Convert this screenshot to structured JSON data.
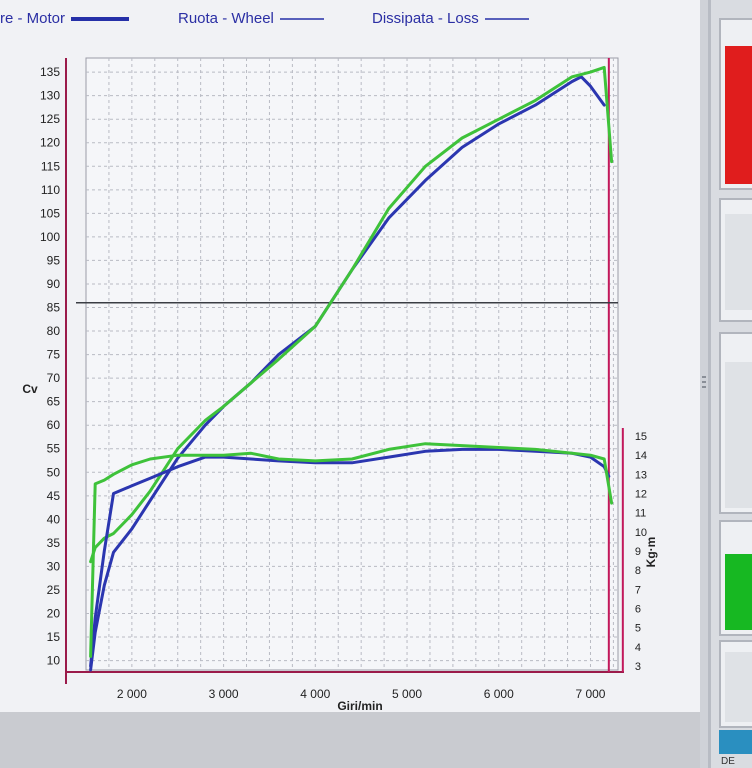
{
  "legend": {
    "items": [
      {
        "label": "re - Motor",
        "color": "#2630a8"
      },
      {
        "label": "Ruota - Wheel",
        "color": "#2630a8"
      },
      {
        "label": "Dissipata - Loss",
        "color": "#2630a8"
      }
    ]
  },
  "chart_data": {
    "type": "line",
    "xlabel": "Giri/min",
    "ylabel_left": "Cv",
    "ylabel_right": "Kg·m",
    "xlim": [
      1500,
      7300
    ],
    "ylim_left": [
      8,
      138
    ],
    "ylim_right": [
      3,
      15
    ],
    "x_ticks": [
      2000,
      3000,
      4000,
      5000,
      6000,
      7000
    ],
    "x_tick_labels": [
      "2 000",
      "3 000",
      "4 000",
      "5 000",
      "6 000",
      "7 000"
    ],
    "y_left_ticks": [
      10,
      15,
      20,
      25,
      30,
      35,
      40,
      45,
      50,
      55,
      60,
      65,
      70,
      75,
      80,
      85,
      90,
      95,
      100,
      105,
      110,
      115,
      120,
      125,
      130,
      135
    ],
    "y_right_ticks": [
      3,
      4,
      5,
      6,
      7,
      8,
      9,
      10,
      11,
      12,
      13,
      14,
      15
    ],
    "reference_line_cv": 86,
    "rpm_limit_line": 7200,
    "grid": true,
    "series": [
      {
        "name": "",
        "axis": "left",
        "color": "#2b36b0",
        "x": [
          1550,
          1600,
          1700,
          1800,
          2000,
          2200,
          2500,
          2800,
          3000,
          3300,
          3600,
          4000,
          4400,
          4800,
          5200,
          5600,
          6000,
          6400,
          6800,
          6900,
          7000,
          7150
        ],
        "y": [
          8,
          16,
          26,
          33,
          38,
          44,
          53,
          60,
          64,
          69,
          75,
          81,
          93,
          104,
          112,
          119,
          124,
          128,
          133,
          134,
          132,
          128
        ]
      },
      {
        "name": "",
        "axis": "left",
        "color": "#3ec23a",
        "x": [
          1550,
          1600,
          1700,
          1800,
          2000,
          2200,
          2500,
          2800,
          3000,
          3300,
          3600,
          4000,
          4400,
          4800,
          5200,
          5600,
          6000,
          6400,
          6800,
          7000,
          7150,
          7230
        ],
        "y": [
          31,
          34,
          36,
          37,
          41,
          46,
          55,
          61,
          64,
          69,
          74,
          81,
          93,
          106,
          115,
          121,
          125,
          129,
          134,
          135,
          136,
          116
        ]
      },
      {
        "name": "",
        "axis": "right",
        "color": "#2b36b0",
        "x": [
          1550,
          1600,
          1700,
          1800,
          2000,
          2200,
          2500,
          2800,
          3000,
          3300,
          3600,
          4000,
          4400,
          4800,
          5200,
          5600,
          6000,
          6400,
          6800,
          7000,
          7150,
          7200
        ],
        "y": [
          3,
          5.5,
          9,
          12,
          12.4,
          12.8,
          13.4,
          13.9,
          13.9,
          13.8,
          13.7,
          13.6,
          13.6,
          13.9,
          14.2,
          14.3,
          14.3,
          14.2,
          14.1,
          13.9,
          13.4,
          12.9
        ]
      },
      {
        "name": "",
        "axis": "right",
        "color": "#3ec23a",
        "x": [
          1550,
          1600,
          1700,
          1800,
          2000,
          2200,
          2500,
          2800,
          3000,
          3300,
          3600,
          4000,
          4400,
          4800,
          5200,
          5600,
          6000,
          6400,
          6800,
          7000,
          7150,
          7230
        ],
        "y": [
          3.5,
          12.5,
          12.7,
          13,
          13.5,
          13.8,
          14,
          14,
          14,
          14.1,
          13.8,
          13.7,
          13.8,
          14.3,
          14.6,
          14.5,
          14.4,
          14.3,
          14.1,
          14,
          13.8,
          11.5
        ]
      }
    ]
  },
  "right_panel": {
    "cards": [
      {
        "fill": "#e01d1d"
      },
      {
        "fill": ""
      },
      {
        "fill": ""
      },
      {
        "fill": "#17b822"
      },
      {
        "fill": ""
      }
    ],
    "bottom_label": "DE"
  }
}
